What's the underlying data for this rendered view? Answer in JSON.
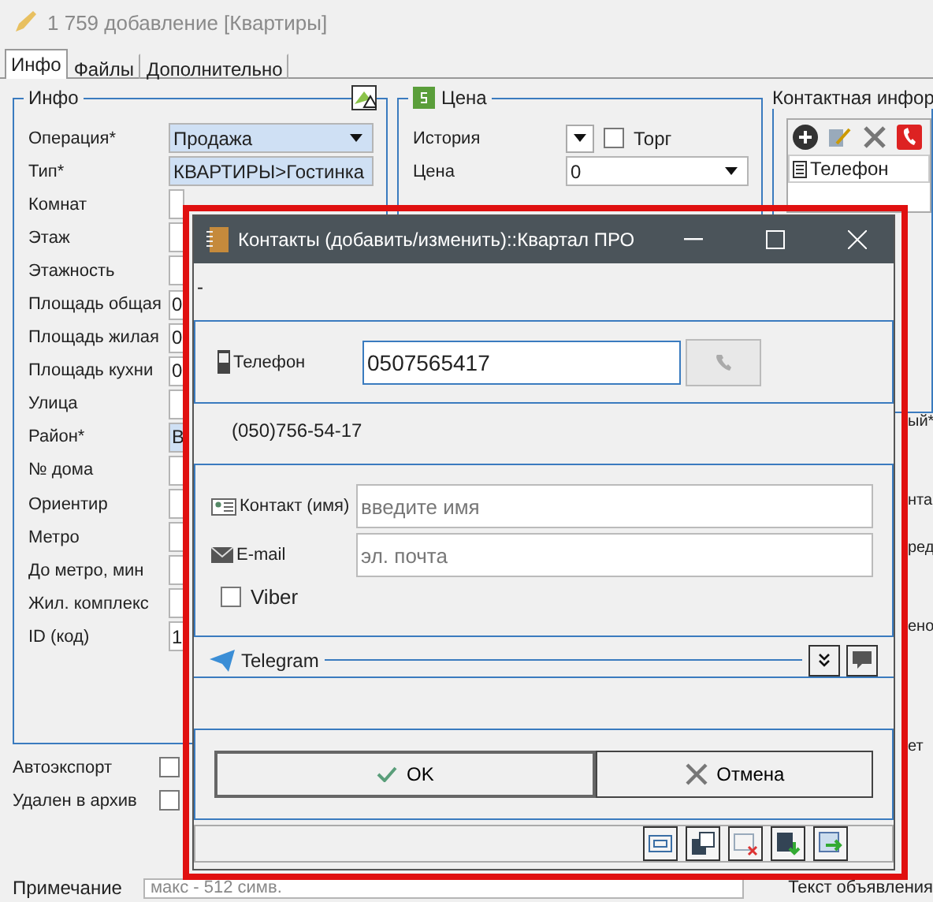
{
  "window": {
    "title": "1 759 добавление [Квартиры]"
  },
  "tabs": [
    {
      "label": "Инфо",
      "selected": true
    },
    {
      "label": "Файлы",
      "selected": false
    },
    {
      "label": "Дополнительно",
      "selected": false
    }
  ],
  "info_group": {
    "title": "Инфо",
    "fields": [
      {
        "label": "Операция*",
        "kind": "dropdown",
        "highlighted": true,
        "value": "Продажа"
      },
      {
        "label": "Тип*",
        "kind": "dropdown",
        "highlighted": true,
        "value": "КВАРТИРЫ>Гостинка"
      },
      {
        "label": "Комнат",
        "kind": "input",
        "highlighted": false
      },
      {
        "label": "Этаж",
        "kind": "input",
        "highlighted": false
      },
      {
        "label": "Этажность",
        "kind": "input",
        "highlighted": false
      },
      {
        "label": "Площадь общая",
        "kind": "input",
        "highlighted": false,
        "value": "0"
      },
      {
        "label": "Площадь жилая",
        "kind": "input",
        "highlighted": false,
        "value": "0"
      },
      {
        "label": "Площадь кухни",
        "kind": "input",
        "highlighted": false,
        "value": "0"
      },
      {
        "label": "Улица",
        "kind": "input",
        "highlighted": false
      },
      {
        "label": "Район*",
        "kind": "input",
        "highlighted": true,
        "value": "В"
      },
      {
        "label": "№ дома",
        "kind": "input",
        "highlighted": false
      },
      {
        "label": "Ориентир",
        "kind": "input",
        "highlighted": false
      },
      {
        "label": "Метро",
        "kind": "input",
        "highlighted": false
      },
      {
        "label": "До метро, мин",
        "kind": "input",
        "highlighted": false
      },
      {
        "label": "Жил. комплекс",
        "kind": "input",
        "highlighted": false
      },
      {
        "label": "ID (код)",
        "kind": "input",
        "highlighted": false,
        "value": "1"
      }
    ]
  },
  "price_group": {
    "title": "Цена",
    "history_label": "История",
    "bargain": {
      "label": "Торг",
      "checked": false
    },
    "price": {
      "label": "Цена",
      "value": "0"
    }
  },
  "contact_group": {
    "title": "Контактная инфор",
    "column": "Телефон"
  },
  "right_fragments": [
    "ый*",
    "нта",
    "ред",
    "ено",
    "ет"
  ],
  "options": [
    {
      "label": "Автоэкспорт",
      "checked": false
    },
    {
      "label": "Удален в архив",
      "checked": false
    }
  ],
  "note": {
    "label": "Примечание",
    "placeholder": "макс - 512 симв."
  },
  "ad_text": {
    "label": "Текст объявления"
  },
  "dialog": {
    "title": "Контакты (добавить/изменить)::Квартал ПРО",
    "dash": "-",
    "phone": {
      "label": "Телефон",
      "value": "0507565417"
    },
    "formatted_phone": "(050)756-54-17",
    "name": {
      "label": "Контакт (имя)",
      "placeholder": "введите имя"
    },
    "email": {
      "label": "E-mail",
      "placeholder": "эл. почта"
    },
    "viber": {
      "label": "Viber",
      "checked": false
    },
    "telegram": {
      "label": "Telegram"
    },
    "buttons": [
      {
        "label": "OK",
        "kind": "ok"
      },
      {
        "label": "Отмена",
        "kind": "cancel"
      }
    ]
  }
}
